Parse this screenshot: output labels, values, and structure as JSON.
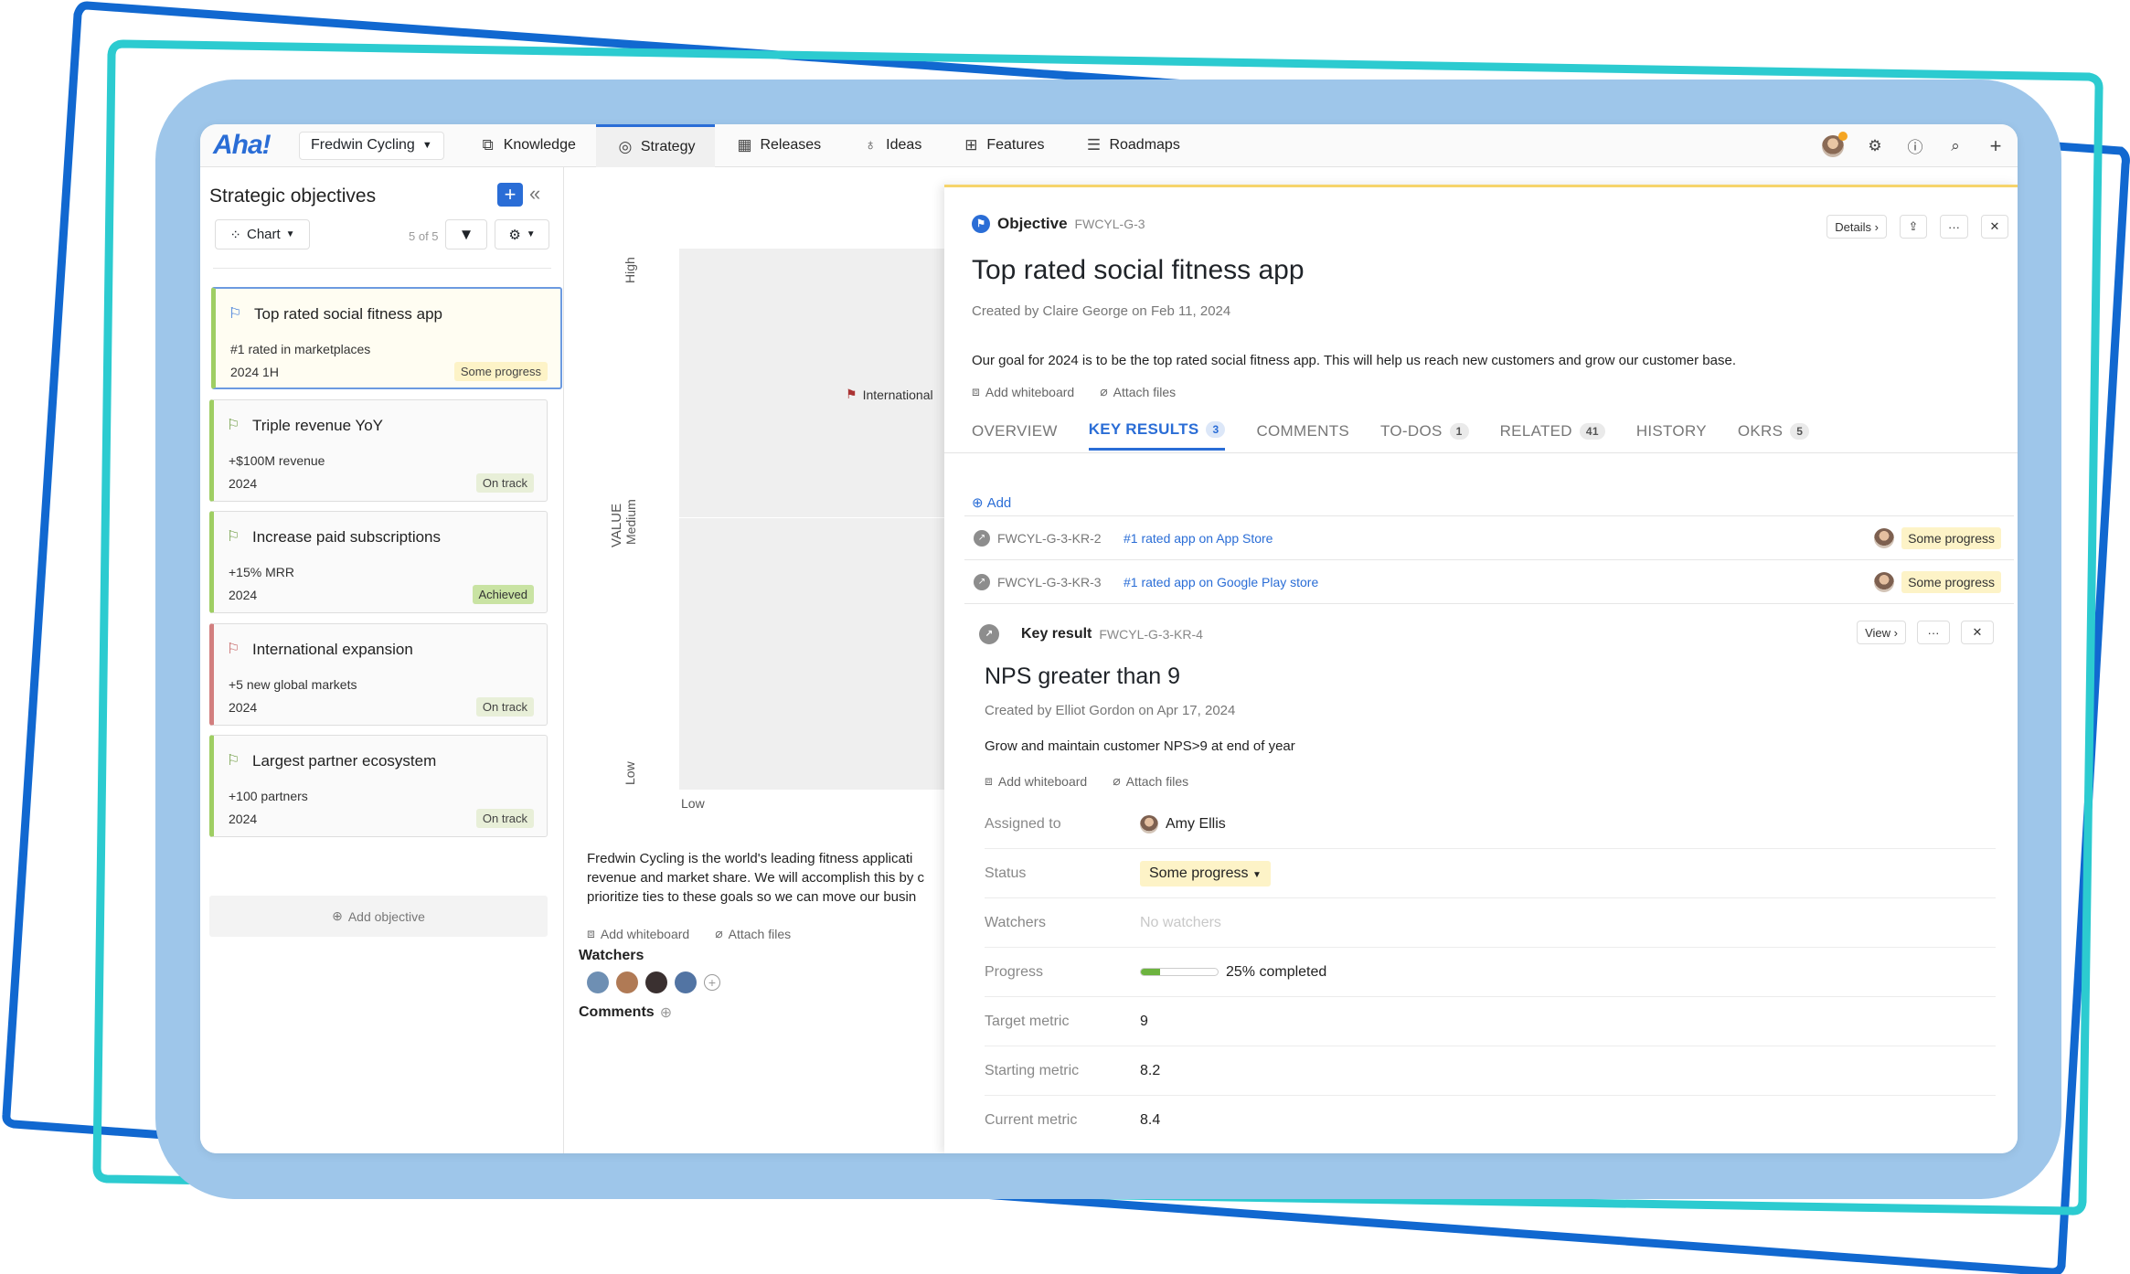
{
  "nav": {
    "logo": "Aha!",
    "workspace": "Fredwin Cycling",
    "items": [
      "Knowledge",
      "Strategy",
      "Releases",
      "Ideas",
      "Features",
      "Roadmaps"
    ],
    "active": "Strategy"
  },
  "left": {
    "title": "Strategic objectives",
    "view_label": "Chart",
    "count": "5 of 5",
    "add_objective": "Add objective",
    "objectives": [
      {
        "title": "Top rated social fitness app",
        "metric": "#1 rated in marketplaces",
        "period": "2024 1H",
        "status": "Some progress"
      },
      {
        "title": "Triple revenue YoY",
        "metric": "+$100M revenue",
        "period": "2024",
        "status": "On track"
      },
      {
        "title": "Increase paid subscriptions",
        "metric": "+15% MRR",
        "period": "2024",
        "status": "Achieved"
      },
      {
        "title": "International expansion",
        "metric": "+5 new global markets",
        "period": "2024",
        "status": "On track"
      },
      {
        "title": "Largest partner ecosystem",
        "metric": "+100 partners",
        "period": "2024",
        "status": "On track"
      }
    ]
  },
  "middle": {
    "axis_title": "VALUE",
    "y_high": "High",
    "y_medium": "Medium",
    "y_low": "Low",
    "x_low": "Low",
    "point_label": "International",
    "desc_1": "Fredwin Cycling is the world's leading fitness applicati",
    "desc_2": "revenue and market share. We will accomplish this by c",
    "desc_3": "prioritize ties to these goals so we can move our busin",
    "add_whiteboard": "Add whiteboard",
    "attach_files": "Attach files",
    "watchers_label": "Watchers",
    "comments_label": "Comments"
  },
  "drawer": {
    "type_label": "Objective",
    "id": "FWCYL-G-3",
    "details_btn": "Details",
    "title": "Top rated social fitness app",
    "created": "Created by Claire George on Feb 11, 2024",
    "description": "Our goal for 2024 is to be the top rated social fitness app. This will help us reach new customers and grow our customer base.",
    "add_whiteboard": "Add whiteboard",
    "attach_files": "Attach files",
    "tabs": [
      {
        "label": "OVERVIEW",
        "count": ""
      },
      {
        "label": "KEY RESULTS",
        "count": "3"
      },
      {
        "label": "COMMENTS",
        "count": ""
      },
      {
        "label": "TO-DOS",
        "count": "1"
      },
      {
        "label": "RELATED",
        "count": "41"
      },
      {
        "label": "HISTORY",
        "count": ""
      },
      {
        "label": "OKRS",
        "count": "5"
      }
    ],
    "add_label": "Add",
    "key_results": [
      {
        "id": "FWCYL-G-3-KR-2",
        "name": "#1 rated app on App Store",
        "status": "Some progress"
      },
      {
        "id": "FWCYL-G-3-KR-3",
        "name": "#1 rated app on Google Play store",
        "status": "Some progress"
      }
    ],
    "kr_detail": {
      "type_label": "Key result",
      "id": "FWCYL-G-3-KR-4",
      "view_btn": "View",
      "title": "NPS greater than 9",
      "created": "Created by Elliot Gordon on Apr 17, 2024",
      "description": "Grow and maintain customer NPS>9 at end of year",
      "add_whiteboard": "Add whiteboard",
      "attach_files": "Attach files",
      "fields": {
        "assigned_label": "Assigned to",
        "assigned_value": "Amy Ellis",
        "status_label": "Status",
        "status_value": "Some progress",
        "watchers_label": "Watchers",
        "watchers_value": "No watchers",
        "progress_label": "Progress",
        "progress_value": "25% completed",
        "progress_fraction": 0.25,
        "target_label": "Target metric",
        "target_value": "9",
        "starting_label": "Starting metric",
        "starting_value": "8.2",
        "current_label": "Current metric",
        "current_value": "8.4"
      }
    }
  },
  "colors": {
    "accent": "#2a6dd6",
    "frame_blue": "#1168d0",
    "frame_teal": "#2ccbd0",
    "bg_blue": "#9ec6ea"
  }
}
